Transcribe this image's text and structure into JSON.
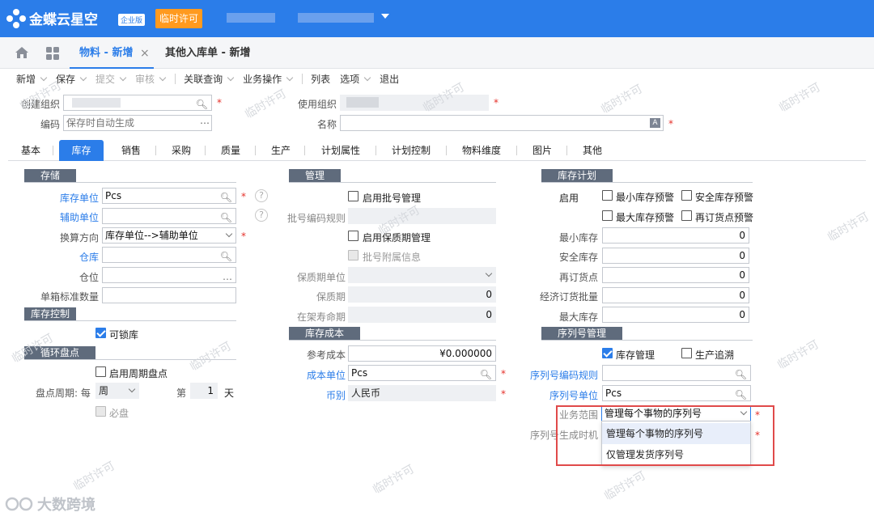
{
  "header": {
    "logo_text": "金蝶云星空",
    "edition": "企业版",
    "temp_license": "临时许可"
  },
  "page_tabs": {
    "material": "物料 - 新增",
    "close": "×",
    "other": "其他入库单 - 新增"
  },
  "toolbar": {
    "new": "新增",
    "save": "保存",
    "submit": "提交",
    "audit": "审核",
    "related": "关联查询",
    "business": "业务操作",
    "list": "列表",
    "options": "选项",
    "exit": "退出"
  },
  "form": {
    "create_org_label": "创建组织",
    "use_org_label": "使用组织",
    "code_label": "编码",
    "code_placeholder": "保存时自动生成",
    "name_label": "名称"
  },
  "tabs": [
    "基本",
    "库存",
    "销售",
    "采购",
    "质量",
    "生产",
    "计划属性",
    "计划控制",
    "物料维度",
    "图片",
    "其他"
  ],
  "storage": {
    "title": "存储",
    "stock_unit_label": "库存单位",
    "stock_unit_value": "Pcs",
    "aux_unit_label": "辅助单位",
    "conversion_label": "换算方向",
    "conversion_value": "库存单位-->辅助单位",
    "warehouse_label": "仓库",
    "location_label": "仓位",
    "box_qty_label": "单箱标准数量"
  },
  "stock_control": {
    "title": "库存控制",
    "lockable_label": "可锁库"
  },
  "cycle_count": {
    "title": "循环盘点",
    "enable_label": "启用周期盘点",
    "period_label": "盘点周期: 每",
    "period_value": "周",
    "day_prefix": "第",
    "day_value": "1",
    "day_suffix": "天",
    "required_label": "必盘"
  },
  "management": {
    "title": "管理",
    "batch_label": "启用批号管理",
    "batch_rule_label": "批号编码规则",
    "shelf_label": "启用保质期管理",
    "batch_attach_label": "批号附属信息",
    "shelf_unit_label": "保质期单位",
    "shelf_life_label": "保质期",
    "shelf_life_value": "0",
    "shelf_remain_label": "在架寿命期",
    "shelf_remain_value": "0"
  },
  "stock_cost": {
    "title": "库存成本",
    "ref_cost_label": "参考成本",
    "ref_cost_value": "¥0.000000",
    "cost_unit_label": "成本单位",
    "cost_unit_value": "Pcs",
    "currency_label": "币别",
    "currency_value": "人民币"
  },
  "stock_plan": {
    "title": "库存计划",
    "enable_label": "启用",
    "min_warn": "最小库存预警",
    "safety_warn": "安全库存预警",
    "max_warn": "最大库存预警",
    "reorder_warn": "再订货点预警",
    "min_stock_label": "最小库存",
    "safety_stock_label": "安全库存",
    "reorder_label": "再订货点",
    "eoq_label": "经济订货批量",
    "max_stock_label": "最大库存",
    "zero": "0"
  },
  "serial": {
    "title": "序列号管理",
    "stock_mgmt_label": "库存管理",
    "prod_trace_label": "生产追溯",
    "rule_label": "序列号编码规则",
    "unit_label": "序列号单位",
    "unit_value": "Pcs",
    "scope_label": "业务范围",
    "scope_value": "管理每个事物的序列号",
    "gen_label": "序列号生成时机",
    "options": [
      "管理每个事物的序列号",
      "仅管理发货序列号"
    ]
  },
  "watermark": "临时许可",
  "bottom_brand": "大数跨境",
  "colors": {
    "primary": "#2b7de9",
    "license": "#ff9a1f",
    "section": "#5f6b7c",
    "highlight": "#e04a4a"
  }
}
